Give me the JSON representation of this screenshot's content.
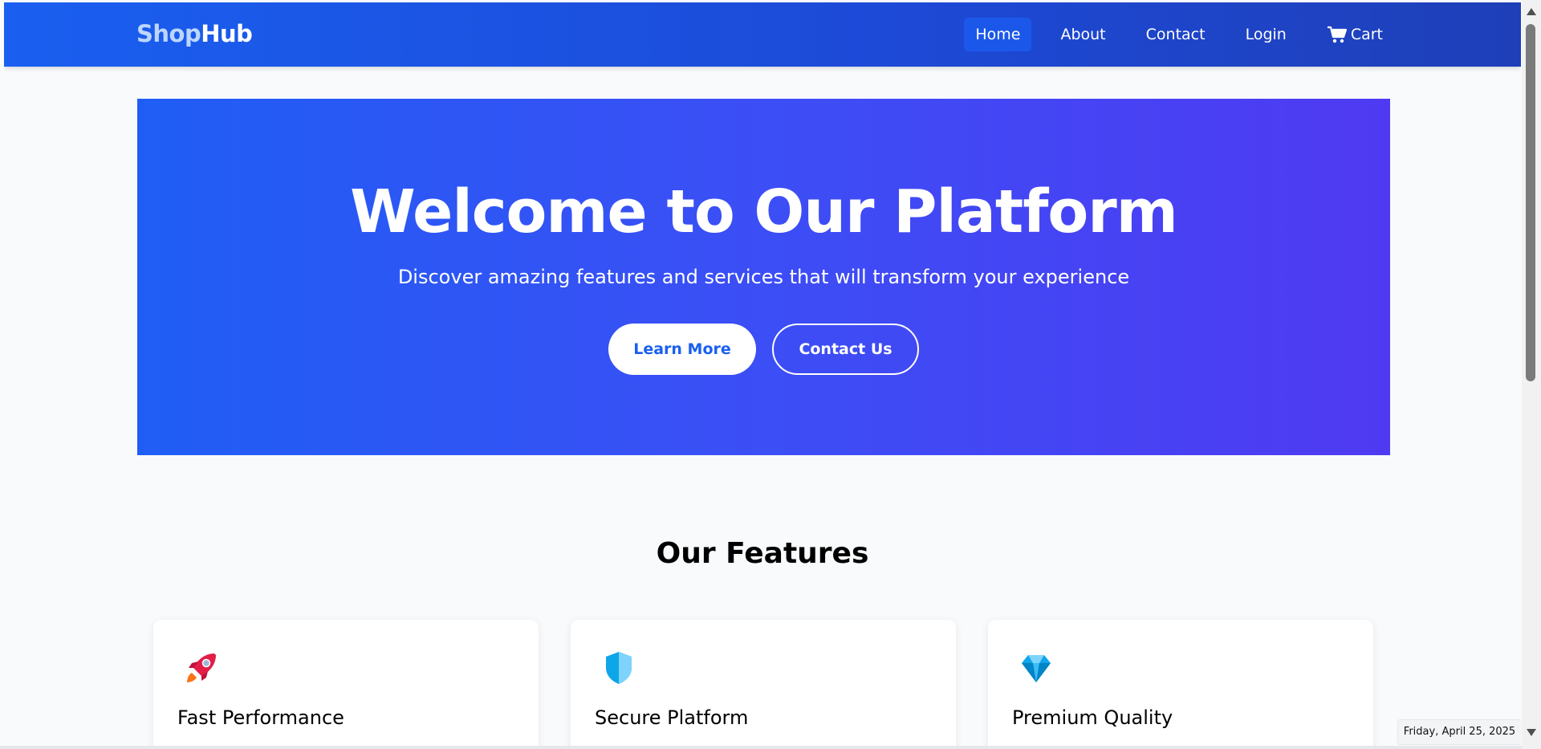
{
  "navbar": {
    "brand_part1": "Shop",
    "brand_part2": "Hub",
    "items": [
      {
        "label": "Home",
        "active": true
      },
      {
        "label": "About",
        "active": false
      },
      {
        "label": "Contact",
        "active": false
      },
      {
        "label": "Login",
        "active": false
      }
    ],
    "cart_label": "Cart",
    "cart_icon": "cart-icon"
  },
  "hero": {
    "title": "Welcome to Our Platform",
    "subtitle": "Discover amazing features and services that will transform your experience",
    "primary_button": "Learn More",
    "secondary_button": "Contact Us"
  },
  "features": {
    "title": "Our Features",
    "cards": [
      {
        "title": "Fast Performance",
        "icon": "rocket-icon"
      },
      {
        "title": "Secure Platform",
        "icon": "shield-icon"
      },
      {
        "title": "Premium Quality",
        "icon": "gem-icon"
      }
    ]
  },
  "date_chip": "Friday, April 25, 2025",
  "colors": {
    "nav_start": "#1a5ff0",
    "nav_end": "#1e3fb8",
    "hero_start": "#1f5ef5",
    "hero_end": "#4f3af2",
    "page_bg": "#f8fafc"
  }
}
